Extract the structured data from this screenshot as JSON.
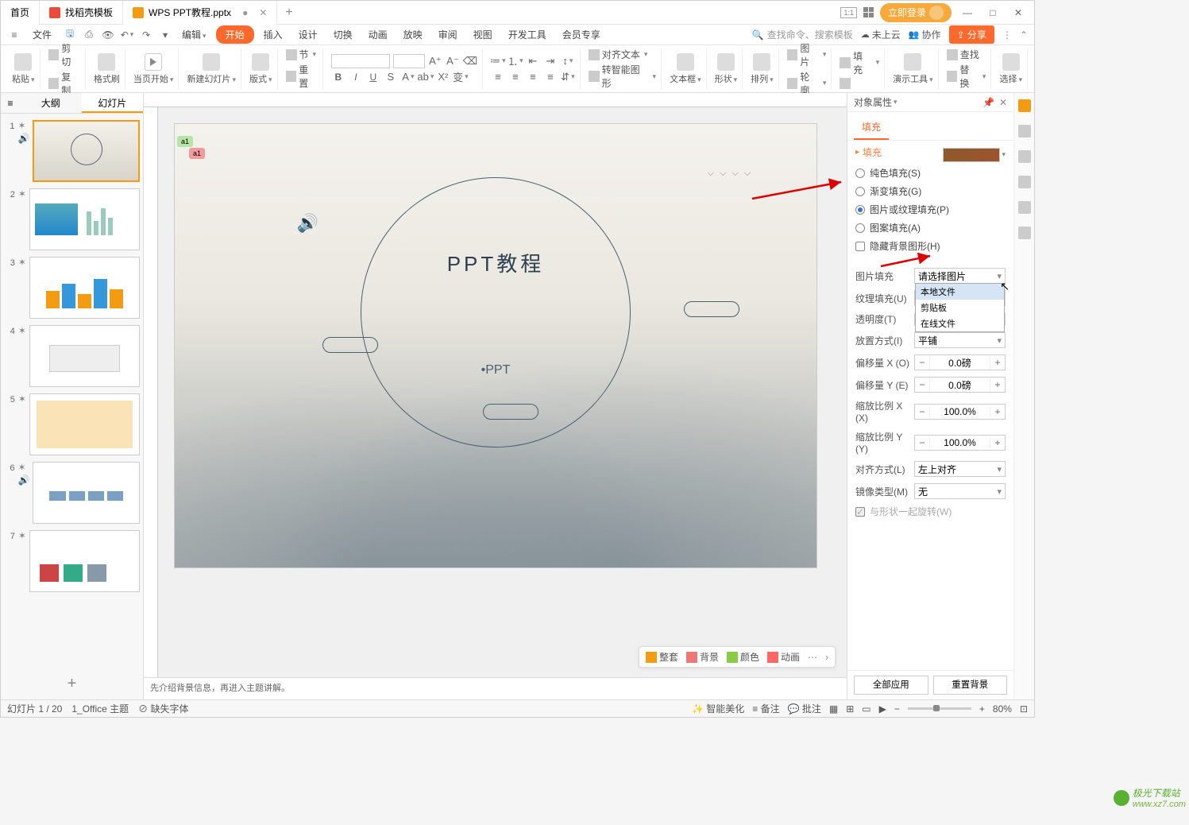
{
  "titlebar": {
    "tabs": [
      {
        "label": "首页"
      },
      {
        "label": "找稻壳模板"
      },
      {
        "label": "WPS PPT教程.pptx",
        "active": true
      }
    ],
    "login": "立即登录",
    "window_controls": [
      "—",
      "□",
      "✕"
    ]
  },
  "menubar": {
    "file_menu": "文件",
    "items": [
      "编辑",
      "开始",
      "插入",
      "设计",
      "切换",
      "动画",
      "放映",
      "审阅",
      "视图",
      "开发工具",
      "会员专享"
    ],
    "search_placeholder": "查找命令、搜索模板",
    "cloud": "未上云",
    "collab": "协作",
    "share": "分享"
  },
  "ribbon": {
    "paste": "粘贴",
    "cut": "剪切",
    "copy": "复制",
    "format_painter": "格式刷",
    "current_start": "当页开始",
    "new_slide": "新建幻灯片",
    "layout": "版式",
    "section": "节",
    "reset": "重置",
    "font_name": "",
    "font_size": "",
    "textbox": "文本框",
    "shape": "形状",
    "arrange": "排列",
    "picture": "图片",
    "fill": "填充",
    "outline": "轮廓",
    "smart_graphic": "转智能图形",
    "align_text": "对齐文本",
    "presentation_tool": "演示工具",
    "find_replace": "查找",
    "replace": "替换",
    "select": "选择"
  },
  "slidepanel": {
    "tab_outline": "大纲",
    "tab_slides": "幻灯片",
    "slide_count": 7
  },
  "slide": {
    "title": "PPT教程",
    "subtitle": "•PPT",
    "bubble1": "a1",
    "bubble2": "a1"
  },
  "float_toolbar": {
    "items": [
      "整套",
      "背景",
      "颜色",
      "动画"
    ]
  },
  "notes": "先介绍背景信息，再进入主题讲解。",
  "proppanel": {
    "title": "对象属性",
    "tab_fill": "填充",
    "section_fill": "填充",
    "radios": {
      "solid": "纯色填充(S)",
      "gradient": "渐变填充(G)",
      "picture": "图片或纹理填充(P)",
      "pattern": "图案填充(A)"
    },
    "hide_bg": "隐藏背景图形(H)",
    "picture_fill": "图片填充",
    "picture_select": "请选择图片",
    "dd_items": [
      "本地文件",
      "剪贴板",
      "在线文件"
    ],
    "texture_fill": "纹理填充(U)",
    "opacity": "透明度(T)",
    "tile": "放置方式(I)",
    "tile_value": "平铺",
    "offset_x": "偏移量 X (O)",
    "offset_x_val": "0.0磅",
    "offset_y": "偏移量 Y (E)",
    "offset_y_val": "0.0磅",
    "scale_x": "缩放比例 X (X)",
    "scale_x_val": "100.0%",
    "scale_y": "缩放比例 Y (Y)",
    "scale_y_val": "100.0%",
    "align": "对齐方式(L)",
    "align_val": "左上对齐",
    "mirror": "镜像类型(M)",
    "mirror_val": "无",
    "rotate_with_shape": "与形状一起旋转(W)",
    "footer_all": "全部应用",
    "footer_reset": "重置背景"
  },
  "statusbar": {
    "slide_pos": "幻灯片 1 / 20",
    "theme": "1_Office 主题",
    "font_missing": "缺失字体",
    "smart_beautify": "智能美化",
    "notes_btn": "备注",
    "comments_btn": "批注",
    "zoom": "80%"
  },
  "watermark": {
    "name": "极光下载站",
    "url": "www.xz7.com"
  }
}
